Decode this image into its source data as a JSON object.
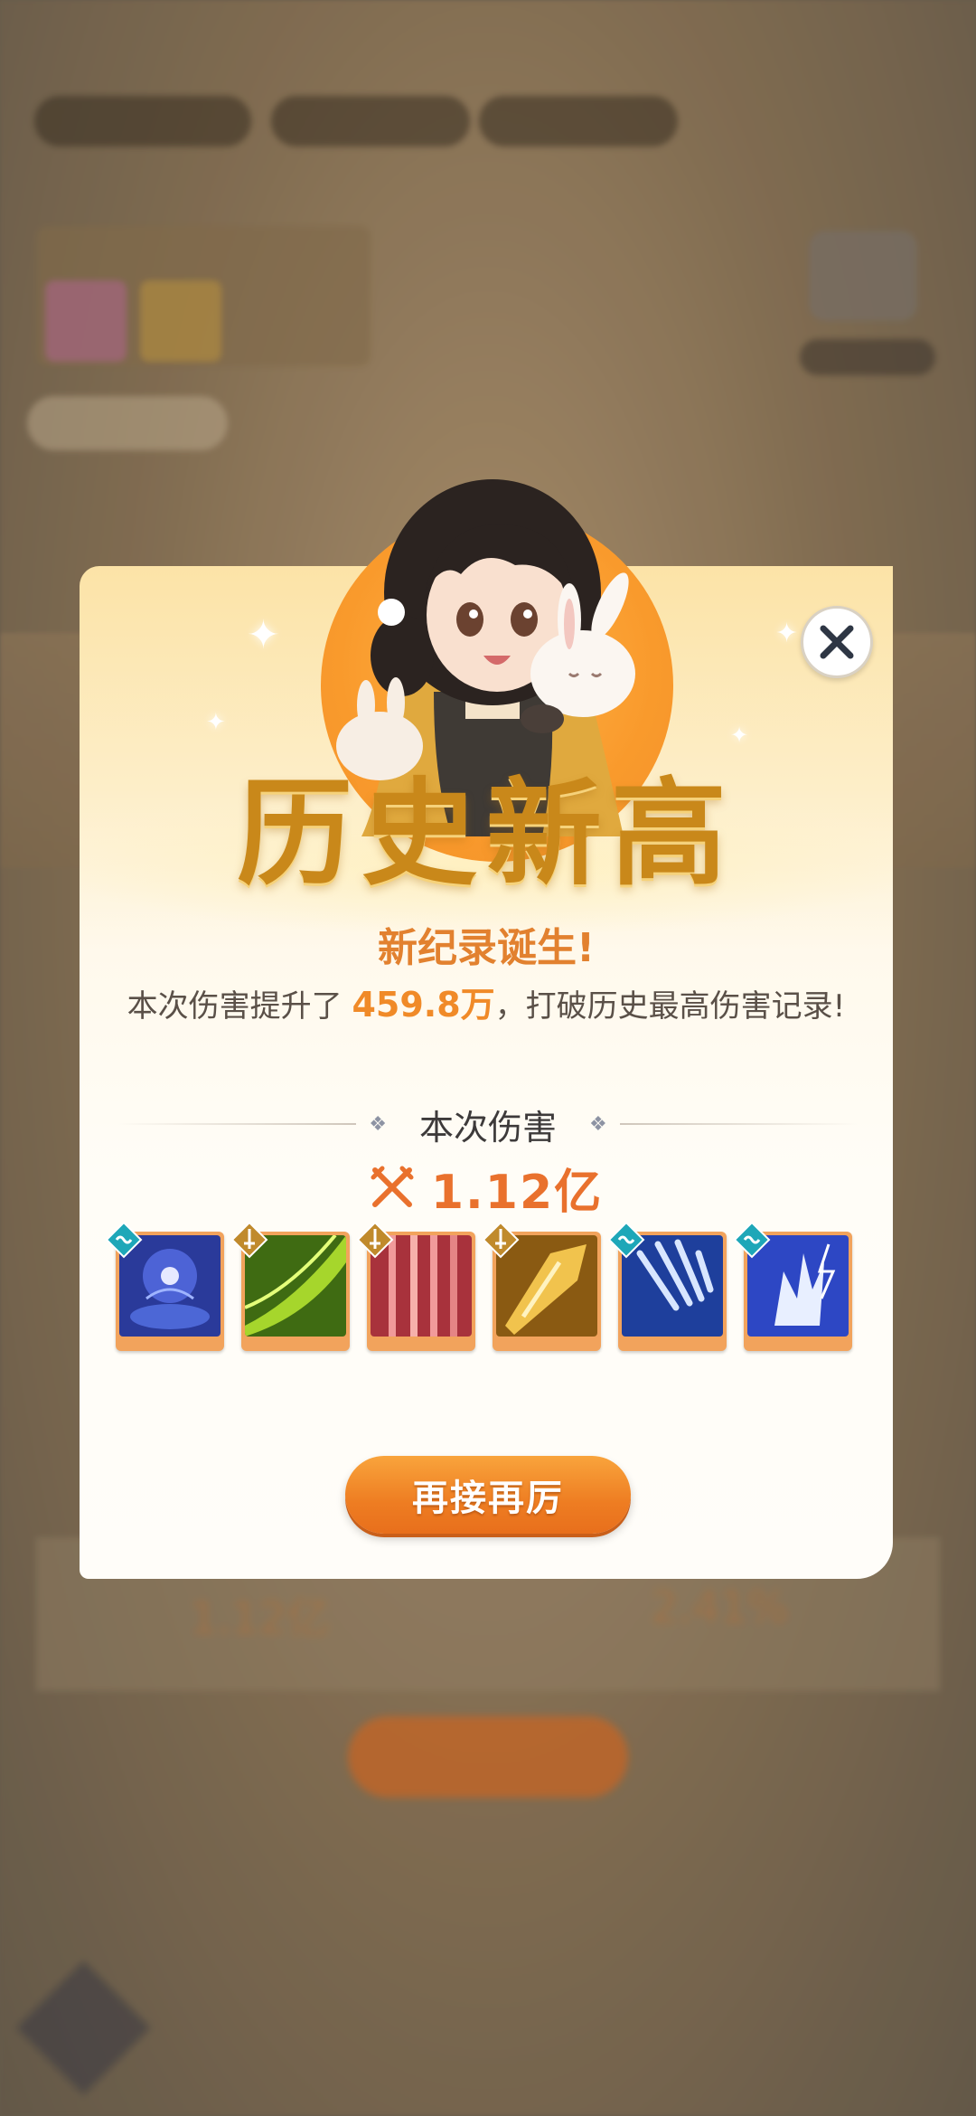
{
  "popup": {
    "title": "历史新高",
    "subtitle": "新纪录诞生!",
    "description_prefix": "本次伤害提升了",
    "description_value": "459.8万",
    "description_suffix": "，打破历史最高伤害记录!",
    "section_label": "本次伤害",
    "damage_value": "1.12亿",
    "retry_button": "再接再厉",
    "skills": [
      {
        "element": "water",
        "art": "blue-goddess"
      },
      {
        "element": "sword",
        "art": "green-slash"
      },
      {
        "element": "sword",
        "art": "red-blades"
      },
      {
        "element": "sword",
        "art": "gold-strike"
      },
      {
        "element": "water",
        "art": "blue-claw"
      },
      {
        "element": "water",
        "art": "lightning-hand"
      }
    ]
  },
  "background": {
    "table_value_left": "1.12亿",
    "table_value_right": "2.41%"
  },
  "colors": {
    "accent_orange": "#f08a28",
    "title_gold": "#c9881a",
    "button_orange": "#ee7d22"
  }
}
